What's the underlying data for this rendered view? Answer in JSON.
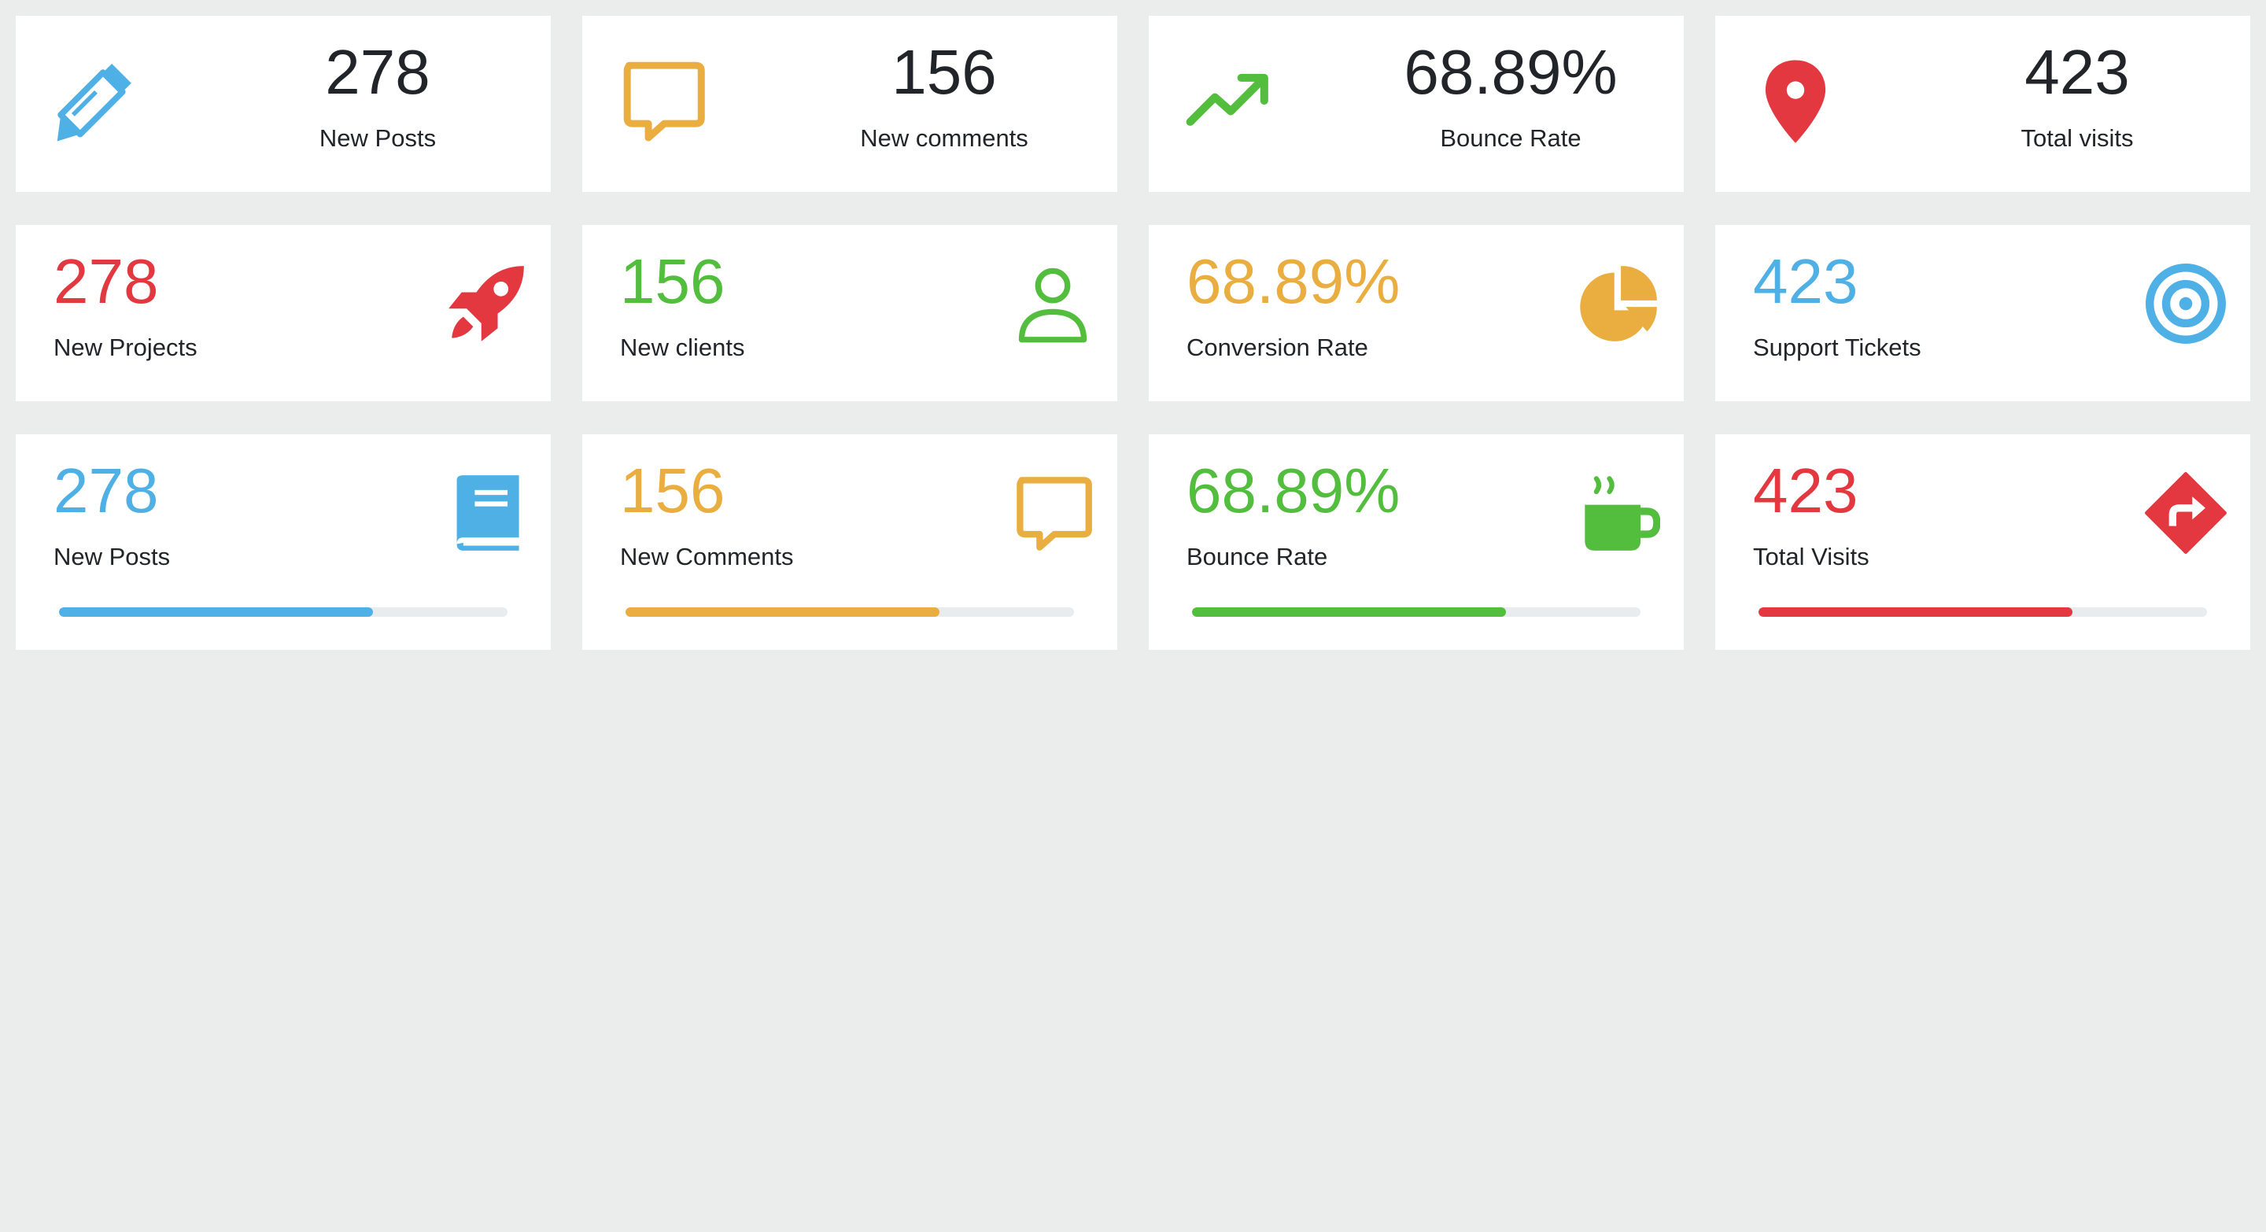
{
  "colors": {
    "blue": "#4fb0e6",
    "orange": "#e9ad40",
    "green": "#53bd3e",
    "red": "#e3383f",
    "dark": "#212529"
  },
  "row1": [
    {
      "value": "278",
      "label": "New Posts",
      "icon": "pencil-icon"
    },
    {
      "value": "156",
      "label": "New comments",
      "icon": "comment-icon"
    },
    {
      "value": "68.89%",
      "label": "Bounce Rate",
      "icon": "trend-up-icon"
    },
    {
      "value": "423",
      "label": "Total visits",
      "icon": "map-marker-icon"
    }
  ],
  "row2": [
    {
      "value": "278",
      "label": "New Projects",
      "icon": "rocket-icon"
    },
    {
      "value": "156",
      "label": "New clients",
      "icon": "user-icon"
    },
    {
      "value": "68.89%",
      "label": "Conversion Rate",
      "icon": "pie-chart-icon"
    },
    {
      "value": "423",
      "label": "Support Tickets",
      "icon": "target-icon"
    }
  ],
  "row3": [
    {
      "value": "278",
      "label": "New Posts",
      "icon": "book-icon",
      "progress": 0.7
    },
    {
      "value": "156",
      "label": "New Comments",
      "icon": "comment-icon",
      "progress": 0.7
    },
    {
      "value": "68.89%",
      "label": "Bounce Rate",
      "icon": "coffee-icon",
      "progress": 0.7
    },
    {
      "value": "423",
      "label": "Total Visits",
      "icon": "directions-icon",
      "progress": 0.7
    }
  ]
}
